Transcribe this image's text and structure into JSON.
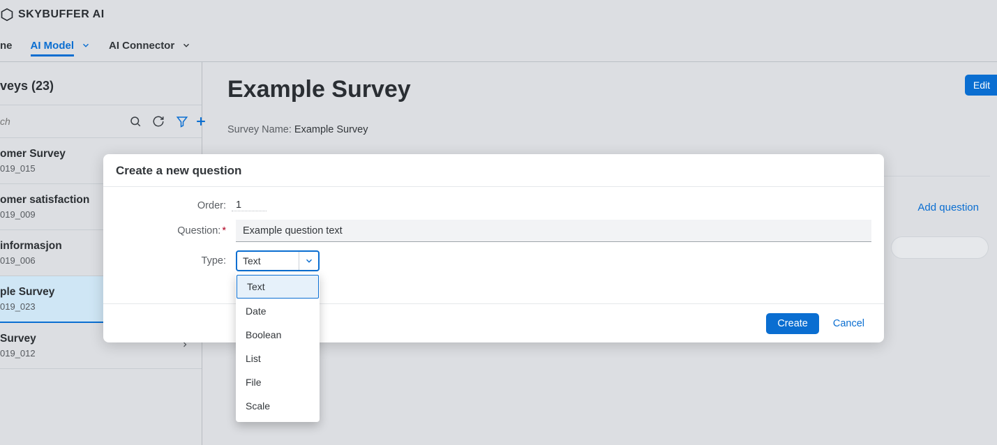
{
  "brand": "SKYBUFFER AI",
  "tabs": {
    "truncated": "ne",
    "ai_model": "AI Model",
    "ai_connector": "AI Connector"
  },
  "sidebar": {
    "title": "veys (23)",
    "search_placeholder": "ch",
    "items": [
      {
        "title": "omer Survey",
        "sub": "019_015",
        "has_chevron": false,
        "selected": false
      },
      {
        "title": "omer satisfaction",
        "sub": "019_009",
        "has_chevron": false,
        "selected": false
      },
      {
        "title": "informasjon",
        "sub": "019_006",
        "has_chevron": false,
        "selected": false
      },
      {
        "title": "ple Survey",
        "sub": "019_023",
        "has_chevron": true,
        "selected": true
      },
      {
        "title": "Survey",
        "sub": "019_012",
        "has_chevron": true,
        "selected": false
      }
    ]
  },
  "main": {
    "title": "Example Survey",
    "edit_label": "Edit",
    "survey_name_label": "Survey Name:",
    "survey_name_value": "Example Survey",
    "add_question_label": "Add question"
  },
  "dialog": {
    "title": "Create a new question",
    "order_label": "Order:",
    "order_value": "1",
    "question_label": "Question:",
    "question_value": "Example question text",
    "type_label": "Type:",
    "type_value": "Text",
    "type_options": [
      "Text",
      "Date",
      "Boolean",
      "List",
      "File",
      "Scale"
    ],
    "create_label": "Create",
    "cancel_label": "Cancel"
  }
}
